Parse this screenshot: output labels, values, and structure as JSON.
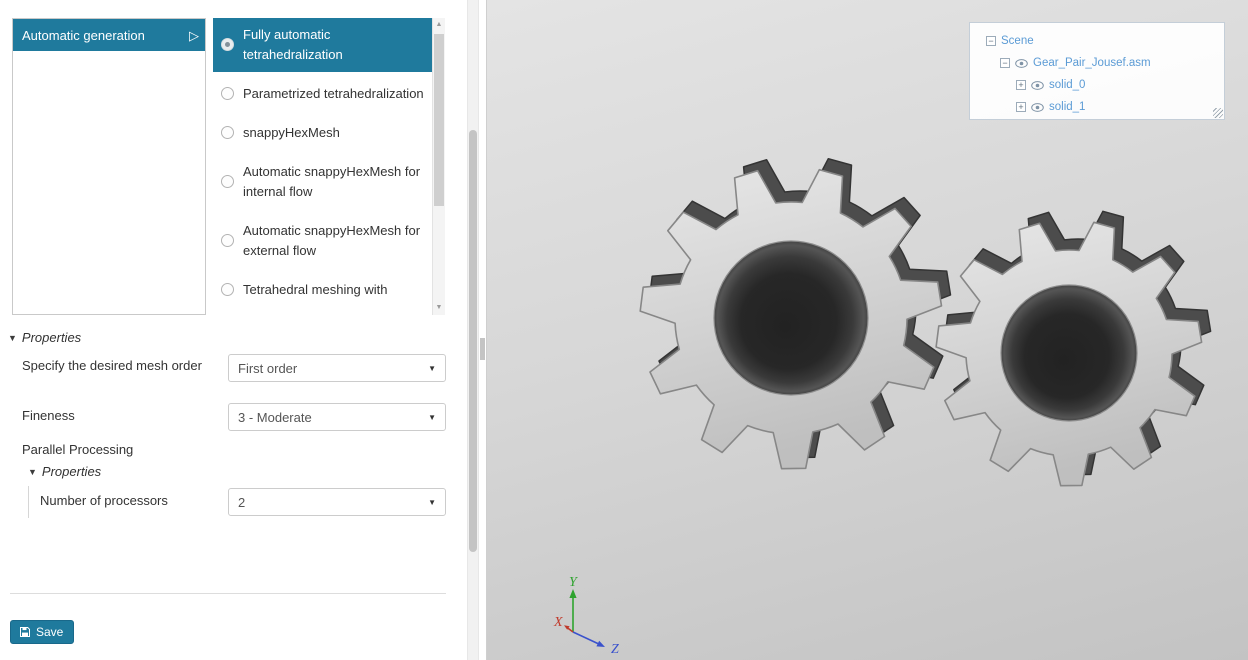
{
  "accent": "#1f7a9d",
  "left_panel": {
    "generator": {
      "label": "Automatic generation"
    },
    "mesh_options": [
      {
        "label": "Fully automatic tetrahedralization"
      },
      {
        "label": "Parametrized tetrahedralization"
      },
      {
        "label": "snappyHexMesh"
      },
      {
        "label": "Automatic snappyHexMesh for internal flow"
      },
      {
        "label": "Automatic snappyHexMesh for external flow"
      },
      {
        "label": "Tetrahedral meshing with"
      }
    ],
    "properties": {
      "header": "Properties",
      "mesh_order": {
        "label": "Specify the desired mesh order",
        "value": "First order"
      },
      "fineness": {
        "label": "Fineness",
        "value": "3 - Moderate"
      },
      "parallel": {
        "label": "Parallel Processing",
        "header": "Properties",
        "processors": {
          "label": "Number of processors",
          "value": "2"
        }
      }
    },
    "save_label": "Save"
  },
  "viewport": {
    "scene_tree": {
      "root": "Scene",
      "assembly": "Gear_Pair_Jousef.asm",
      "solids": [
        "solid_0",
        "solid_1"
      ],
      "collapse_glyph": "−",
      "expand_glyph": "+"
    },
    "axes": {
      "x": "X",
      "y": "Y",
      "z": "Z"
    },
    "axis_colors": {
      "x": "#c03a2b",
      "y": "#2fa32f",
      "z": "#3a52cc"
    }
  },
  "icons": {
    "play": "▷",
    "caret_down": "▼",
    "scroll_up": "▲",
    "scroll_down": "▼"
  }
}
